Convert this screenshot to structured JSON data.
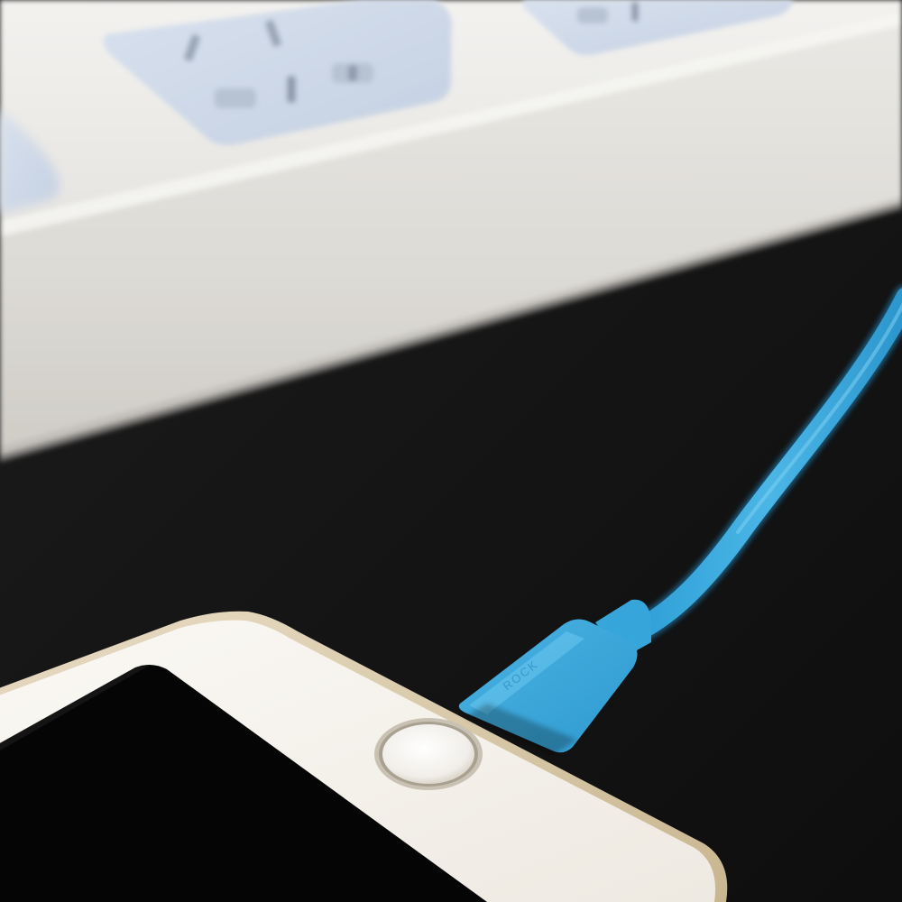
{
  "scene": {
    "description_free": true,
    "colors": {
      "table": "#141414",
      "power_strip": "#ecebe8",
      "socket_panel": "#cfd9e8",
      "cable": "#3aa9dc",
      "phone_body": "#f6f3ee",
      "phone_screen": "#050505",
      "home_button_ring": "#c9c2b4"
    }
  },
  "cable_connector": {
    "brand_text": "ROCK"
  },
  "icons": {
    "power_strip": "power-strip-icon",
    "socket": "socket-icon",
    "cable": "cable-icon",
    "phone": "phone-icon",
    "home_button": "home-button-icon"
  }
}
